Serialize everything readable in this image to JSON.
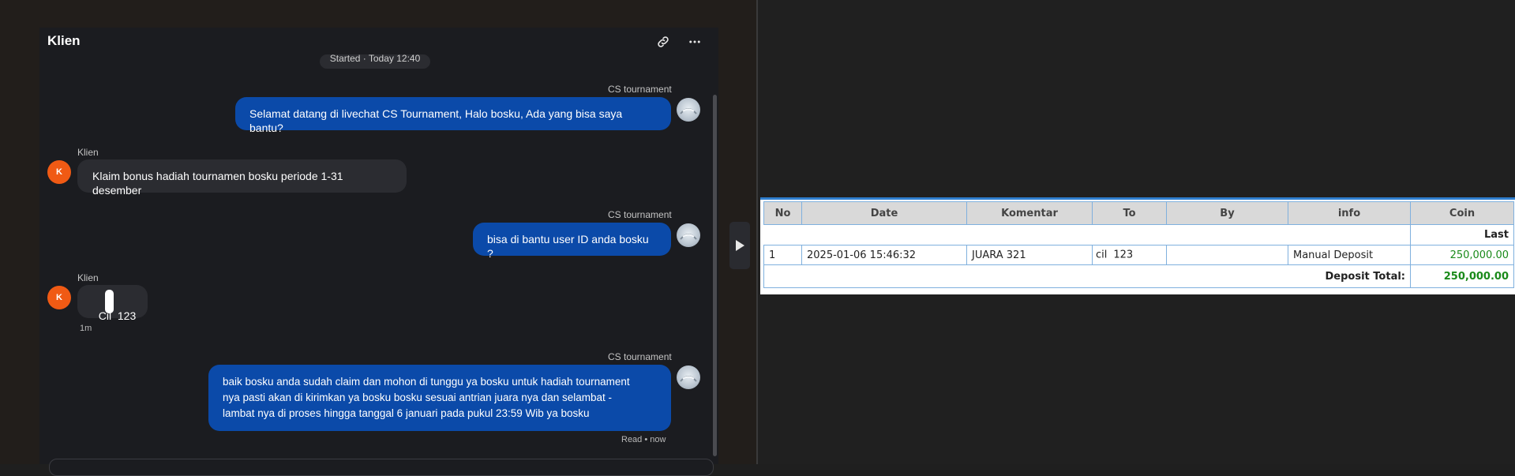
{
  "chat": {
    "title": "Klien",
    "header_icons": [
      "link-icon",
      "more-icon"
    ],
    "started": "Started · Today 12:40",
    "messages": [
      {
        "sender": "CS tournament",
        "text": "Selamat datang di livechat CS Tournament, Halo bosku, Ada yang bisa saya bantu?"
      },
      {
        "sender": "Klien",
        "avatar": "K",
        "text": "Klaim bonus hadiah tournamen bosku periode 1-31 desember"
      },
      {
        "sender": "CS tournament",
        "text": "bisa di bantu user ID anda bosku ?"
      },
      {
        "sender": "Klien",
        "avatar": "K",
        "text": "Cil  123",
        "time": "1m"
      },
      {
        "sender": "CS tournament",
        "lines": [
          "baik bosku anda sudah claim dan mohon di tunggu ya bosku untuk hadiah tournament",
          "nya pasti akan di kirimkan ya bosku bosku sesuai antrian juara nya dan selambat -",
          "lambat nya di proses hingga tanggal 6 januari pada pukul 23:59 Wib ya bosku"
        ],
        "status": "Read • now"
      }
    ]
  },
  "table": {
    "headers": [
      "No",
      "Date",
      "Komentar",
      "To",
      "By",
      "info",
      "Coin"
    ],
    "last_label": "Last",
    "row": {
      "no": "1",
      "date": "2025-01-06 15:46:32",
      "komentar": "JUARA 321",
      "to_part1": "cil",
      "to_part2": "123",
      "by": "",
      "info": "Manual Deposit",
      "coin": "250,000.00"
    },
    "total_label": "Deposit Total:",
    "total_value": "250,000.00"
  },
  "colors": {
    "agent_bubble": "#0b4aa9",
    "client_bubble": "#2b2c31",
    "client_avatar": "#f05a14",
    "coin_green": "#1a8a1a",
    "table_accent": "#2f7fcf"
  }
}
